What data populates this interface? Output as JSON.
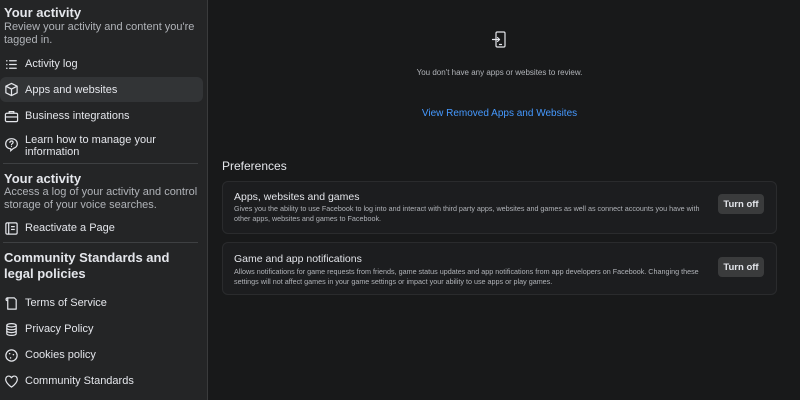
{
  "sidebar": {
    "activity_section": {
      "title": "Your activity",
      "description": "Review your activity and content you're tagged in."
    },
    "activity_items": [
      {
        "label": "Activity log",
        "icon": "list-icon"
      },
      {
        "label": "Apps and websites",
        "icon": "cube-icon",
        "active": true
      },
      {
        "label": "Business integrations",
        "icon": "briefcase-icon"
      },
      {
        "label": "Learn how to manage your information",
        "icon": "help-icon"
      }
    ],
    "activity_section_2": {
      "title": "Your activity",
      "description": "Access a log of your activity and control storage of your voice searches."
    },
    "activity_items_2": [
      {
        "label": "Reactivate a Page",
        "icon": "page-icon"
      }
    ],
    "legal_section": {
      "title": "Community Standards and legal policies"
    },
    "legal_items": [
      {
        "label": "Terms of Service",
        "icon": "terms-icon"
      },
      {
        "label": "Privacy Policy",
        "icon": "database-icon"
      },
      {
        "label": "Cookies policy",
        "icon": "cookie-icon"
      },
      {
        "label": "Community Standards",
        "icon": "heart-icon"
      }
    ]
  },
  "main": {
    "empty_message": "You don't have any apps or websites to review.",
    "removed_link": "View Removed Apps and Websites",
    "preferences": {
      "heading": "Preferences",
      "cards": [
        {
          "title": "Apps, websites and games",
          "description": "Gives you the ability to use Facebook to log into and interact with third party apps, websites and games as well as connect accounts you have with other apps, websites and games to Facebook.",
          "button": "Turn off"
        },
        {
          "title": "Game and app notifications",
          "description": "Allows notifications for game requests from friends, game status updates and app notifications from app developers on Facebook. Changing these settings will not affect games in your game settings or impact your ability to use apps or play games.",
          "button": "Turn off"
        }
      ]
    }
  },
  "colors": {
    "background": "#18191a",
    "sidebar": "#242526",
    "active_item": "#323436",
    "link": "#4599ff",
    "button": "#3a3b3c",
    "text": "#e4e6eb",
    "secondary_text": "#b0b3b8"
  }
}
